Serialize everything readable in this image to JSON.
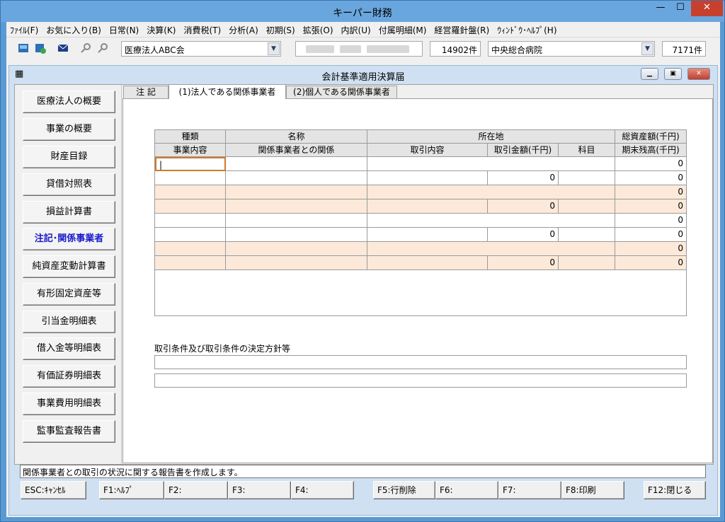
{
  "window": {
    "title": "キーパー財務",
    "min_label": "—",
    "max_label": "☐",
    "close_label": "✕"
  },
  "menu": [
    "ﾌｧｲﾙ(F)",
    "お気に入り(B)",
    "日常(N)",
    "決算(K)",
    "消費税(T)",
    "分析(A)",
    "初期(S)",
    "拡張(O)",
    "内訳(U)",
    "付属明細(M)",
    "経営羅針盤(R)",
    "ｳｨﾝﾄﾞｳ･ﾍﾙﾌﾟ(H)"
  ],
  "toolbar": {
    "company": "医療法人ABC会",
    "count1": "14902件",
    "hospital": "中央総合病院",
    "count2": "7171件",
    "icons": [
      "save-icon",
      "export-icon",
      "mail-icon",
      "search-key-icon",
      "search-key2-icon"
    ]
  },
  "form": {
    "title": "会計基準適用決算届"
  },
  "sidebar": [
    "医療法人の概要",
    "事業の概要",
    "財産目録",
    "貸借対照表",
    "損益計算書",
    "注記･関係事業者",
    "純資産変動計算書",
    "有形固定資産等",
    "引当金明細表",
    "借入金等明細表",
    "有価証券明細表",
    "事業費用明細表",
    "監事監査報告書"
  ],
  "tabs": [
    "注 記",
    "(1)法人である関係事業者",
    "(2)個人である関係事業者"
  ],
  "grid": {
    "header1": [
      "種類",
      "名称",
      "所在地",
      "総資産額(千円)"
    ],
    "header2": [
      "事業内容",
      "関係事業者との関係",
      "取引内容",
      "取引金額(千円)",
      "科目",
      "期末残高(千円)"
    ],
    "rows": [
      {
        "a": "",
        "b": "",
        "c": "",
        "d": "",
        "e": "",
        "f": "0"
      },
      {
        "a": "",
        "b": "",
        "c": "",
        "d": "0",
        "e": "",
        "f": "0"
      },
      {
        "a": "",
        "b": "",
        "c": "",
        "d": "",
        "e": "",
        "f": "0"
      },
      {
        "a": "",
        "b": "",
        "c": "",
        "d": "0",
        "e": "",
        "f": "0"
      },
      {
        "a": "",
        "b": "",
        "c": "",
        "d": "",
        "e": "",
        "f": "0"
      },
      {
        "a": "",
        "b": "",
        "c": "",
        "d": "0",
        "e": "",
        "f": "0"
      },
      {
        "a": "",
        "b": "",
        "c": "",
        "d": "",
        "e": "",
        "f": "0"
      },
      {
        "a": "",
        "b": "",
        "c": "",
        "d": "0",
        "e": "",
        "f": "0"
      }
    ]
  },
  "conditions": {
    "label": "取引条件及び取引条件の決定方針等",
    "line1": "",
    "line2": ""
  },
  "status": "関係事業者との取引の状況に関する報告書を作成します。",
  "fkeys": [
    "ESC:ｷｬﾝｾﾙ",
    "F1:ﾍﾙﾌﾟ",
    "F2:",
    "F3:",
    "F4:",
    "F5:行削除",
    "F6:",
    "F7:",
    "F8:印刷",
    "F12:閉じる"
  ]
}
